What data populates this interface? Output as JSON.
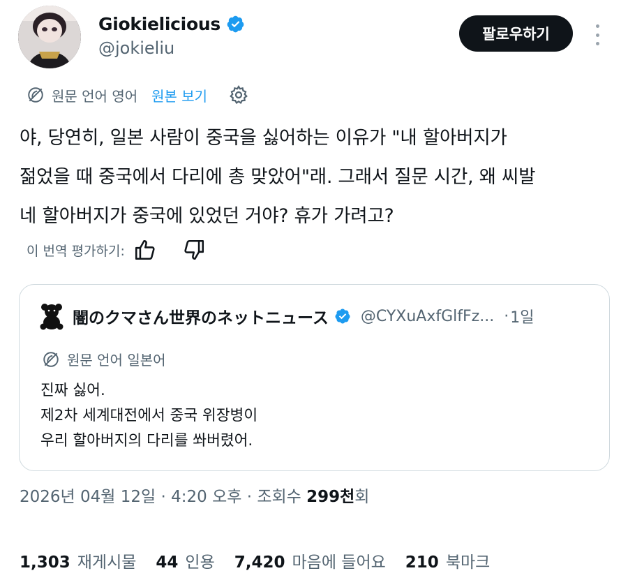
{
  "author": {
    "name": "Giokielicious",
    "handle": "@jokieliu"
  },
  "follow_button": "팔로우하기",
  "translation": {
    "source_language": "원문 언어 영어",
    "show_original": "원본 보기"
  },
  "tweet": {
    "lines": [
      "야, 당연히, 일본 사람이 중국을 싫어하는 이유가 \"내 할아버지가",
      "젊었을 때 중국에서 다리에 총 맞았어\"래. 그래서 질문 시간, 왜 씨발",
      "네 할아버지가 중국에 있었던 거야? 휴가 가려고?"
    ]
  },
  "rate_translation": {
    "label": "이 번역 평가하기:"
  },
  "quote": {
    "name": "闇のクマさん世界のネットニュース",
    "handle": "@CYXuAxfGlfFz...",
    "separator": "·",
    "time": "1일",
    "source_language": "원문 언어 일본어",
    "lines": [
      "진짜 싫어.",
      "제2차 세계대전에서 중국 위장병이",
      "우리 할아버지의 다리를 쏴버렸어."
    ]
  },
  "meta": {
    "date": "2026년 04월 12일",
    "sep1": "·",
    "time": "4:20 오후",
    "sep2": "·",
    "views_label": "조회수",
    "views_value": "299천",
    "views_suffix": "회"
  },
  "stats": {
    "reposts": {
      "value": "1,303",
      "label": "재게시물"
    },
    "quotes": {
      "value": "44",
      "label": "인용"
    },
    "likes": {
      "value": "7,420",
      "label": "마음에 들어요"
    },
    "bookmarks": {
      "value": "210",
      "label": "북마크"
    }
  },
  "colors": {
    "accent": "#1d9bf0",
    "text": "#0f1419",
    "muted": "#536471",
    "border": "#cfd9de"
  },
  "icons": {
    "verified": "verified-badge-icon",
    "translate": "globe-slash-icon",
    "settings": "gear-icon",
    "like": "thumbs-up-icon",
    "dislike": "thumbs-down-icon",
    "more": "more-dots-icon",
    "quote_avatar": "teddy-bear-icon"
  }
}
